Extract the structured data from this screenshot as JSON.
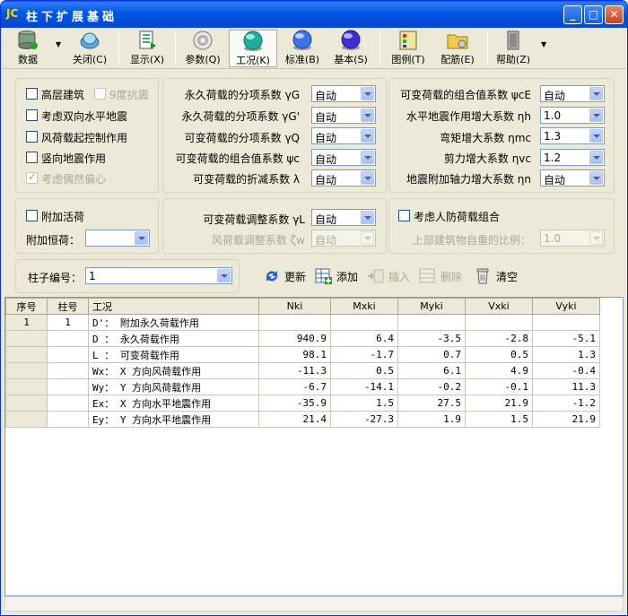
{
  "window": {
    "app_logo": "JC",
    "title": "柱下扩展基础",
    "minimize": "_",
    "maximize": "□",
    "close": "✕"
  },
  "toolbar": {
    "data_label": "数据",
    "close_label": "关闭(C)",
    "display_label": "显示(X)",
    "params_label": "参数(Q)",
    "case_label": "工况(K)",
    "standard_label": "标准(B)",
    "basic_label": "基本(S)",
    "legend_label": "图例(T)",
    "rebar_label": "配筋(E)",
    "help_label": "帮助(Z)"
  },
  "options": {
    "high_rise": "高层建筑",
    "nine_degree": "9度抗震",
    "bidirectional": "考虑双向水平地震",
    "wind_control": "风荷载起控制作用",
    "vertical_quake": "竖向地震作用",
    "accidental": "考虑偶然偏心",
    "extra_live": "附加活荷",
    "extra_dead_label": "附加恒荷：",
    "extra_dead_value": "",
    "civil_defense": "考虑人防荷载组合",
    "upper_ratio_label": "上部建筑物自重的比例：",
    "upper_ratio_value": "1.0"
  },
  "factors_mid": [
    {
      "label": "永久荷载的分项系数 γG",
      "value": "自动"
    },
    {
      "label": "永久荷载的分项系数 γG'",
      "value": "自动"
    },
    {
      "label": "可变荷载的分项系数 γQ",
      "value": "自动"
    },
    {
      "label": "可变荷载的组合值系数 ψc",
      "value": "自动"
    },
    {
      "label": "可变荷载的折减系数 λ",
      "value": "自动"
    }
  ],
  "factors_right": [
    {
      "label": "可变荷载的组合值系数 ψcE",
      "value": "自动"
    },
    {
      "label": "水平地震作用增大系数 ηh",
      "value": "1.0"
    },
    {
      "label": "弯矩增大系数 ηmc",
      "value": "1.3"
    },
    {
      "label": "剪力增大系数 ηvc",
      "value": "1.2"
    },
    {
      "label": "地震附加轴力增大系数 ηn",
      "value": "自动"
    }
  ],
  "adjust": {
    "live_label": "可变荷载调整系数 γL",
    "live_value": "自动",
    "wind_label": "风荷载调整系数 ζw",
    "wind_value": "自动"
  },
  "column": {
    "label": "柱子编号：",
    "value": "1"
  },
  "actions": {
    "refresh": "更新",
    "add": "添加",
    "insert": "插入",
    "delete": "删除",
    "clear": "清空"
  },
  "grid": {
    "headers": [
      "序号",
      "柱号",
      "工况",
      "Nki",
      "Mxki",
      "Myki",
      "Vxki",
      "Vyki"
    ],
    "rows": [
      {
        "idx": "1",
        "col": "1",
        "case": "D'： 附加永久荷载作用",
        "n": "",
        "mx": "",
        "my": "",
        "vx": "",
        "vy": ""
      },
      {
        "idx": "",
        "col": "",
        "case": "D ： 永久荷载作用",
        "n": "940.9",
        "mx": "6.4",
        "my": "-3.5",
        "vx": "-2.8",
        "vy": "-5.1"
      },
      {
        "idx": "",
        "col": "",
        "case": "L ： 可变荷载作用",
        "n": "98.1",
        "mx": "-1.7",
        "my": "0.7",
        "vx": "0.5",
        "vy": "1.3"
      },
      {
        "idx": "",
        "col": "",
        "case": "Wx： X 方向风荷载作用",
        "n": "-11.3",
        "mx": "0.5",
        "my": "6.1",
        "vx": "4.9",
        "vy": "-0.4"
      },
      {
        "idx": "",
        "col": "",
        "case": "Wy： Y 方向风荷载作用",
        "n": "-6.7",
        "mx": "-14.1",
        "my": "-0.2",
        "vx": "-0.1",
        "vy": "11.3"
      },
      {
        "idx": "",
        "col": "",
        "case": "Ex： X 方向水平地震作用",
        "n": "-35.9",
        "mx": "1.5",
        "my": "27.5",
        "vx": "21.9",
        "vy": "-1.2"
      },
      {
        "idx": "",
        "col": "",
        "case": "Ey： Y 方向水平地震作用",
        "n": "21.4",
        "mx": "-27.3",
        "my": "1.9",
        "vx": "1.5",
        "vy": "21.9"
      }
    ]
  }
}
